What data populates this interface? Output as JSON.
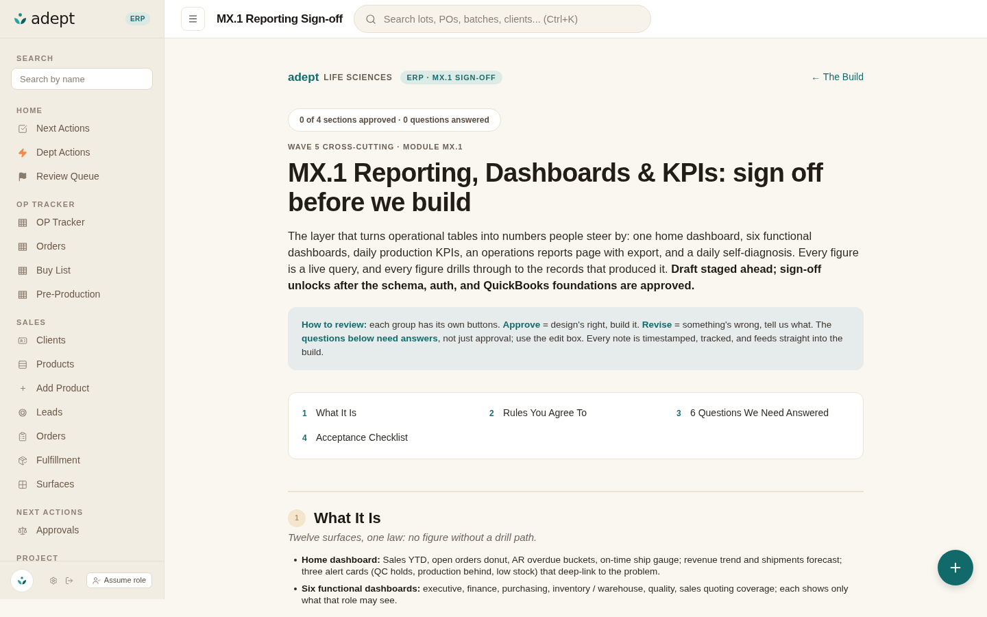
{
  "sidebar": {
    "brand": {
      "name": "adept",
      "badge": "ERP"
    },
    "search": {
      "label": "SEARCH",
      "placeholder": "Search by name"
    },
    "sections": [
      {
        "title": "HOME",
        "items": [
          {
            "label": "Next Actions"
          },
          {
            "label": "Dept Actions"
          },
          {
            "label": "Review Queue"
          }
        ]
      },
      {
        "title": "OP TRACKER",
        "items": [
          {
            "label": "OP Tracker"
          },
          {
            "label": "Orders"
          },
          {
            "label": "Buy List"
          },
          {
            "label": "Pre-Production"
          }
        ]
      },
      {
        "title": "SALES",
        "items": [
          {
            "label": "Clients"
          },
          {
            "label": "Products"
          },
          {
            "label": "Add Product"
          },
          {
            "label": "Leads"
          },
          {
            "label": "Orders"
          },
          {
            "label": "Fulfillment"
          },
          {
            "label": "Surfaces"
          }
        ]
      },
      {
        "title": "NEXT ACTIONS",
        "items": [
          {
            "label": "Approvals"
          }
        ]
      },
      {
        "title": "PROJECT"
      }
    ],
    "footer": {
      "assume_role_button": "Assume role"
    }
  },
  "topbar": {
    "title": "MX.1 Reporting Sign-off",
    "search": {
      "placeholder": "Search lots, POs, batches, clients... (Ctrl+K)"
    }
  },
  "page": {
    "brand": "adept",
    "brand_suffix": "LIFE SCIENCES",
    "tag": "ERP · MX.1 SIGN-OFF",
    "back_link": "← The Build",
    "progress": "0 of 4 sections approved · 0 questions answered",
    "eyebrow": "WAVE 5 CROSS-CUTTING · MODULE MX.1",
    "title": "MX.1 Reporting, Dashboards & KPIs: sign off before we build",
    "intro": "The layer that turns operational tables into numbers people steer by: one home dashboard, six functional dashboards, daily production KPIs, an operations reports page with export, and a daily self-diagnosis. Every figure is a live query, and every figure drills through to the records that produced it. **Draft staged ahead; sign-off unlocks after the schema, auth, and QuickBooks foundations are approved.**",
    "review_note": "**How to review:** each group has its own buttons. **Approve** = design's right, build it. **Revise** = something's wrong, tell us what. The **questions below need answers**, not just approval; use the edit box. Every note is timestamped, tracked, and feeds straight into the build.",
    "toc": [
      {
        "number": "1",
        "label": "What It Is"
      },
      {
        "number": "2",
        "label": "Rules You Agree To"
      },
      {
        "number": "3",
        "label": "6 Questions We Need Answered"
      },
      {
        "number": "4",
        "label": "Acceptance Checklist"
      }
    ],
    "sections": [
      {
        "number": "1",
        "title": "What It Is",
        "subtitle": "Twelve surfaces, one law: no figure without a drill path.",
        "bullets": [
          "**Home dashboard:** Sales YTD, open orders donut, AR overdue buckets, on-time ship gauge; revenue trend and shipments forecast; three alert cards (QC holds, production behind, low stock) that deep-link to the problem.",
          "**Six functional dashboards:** executive, finance, purchasing, inventory / warehouse, quality, sales quoting coverage; each shows only what that role may see."
        ]
      }
    ]
  }
}
